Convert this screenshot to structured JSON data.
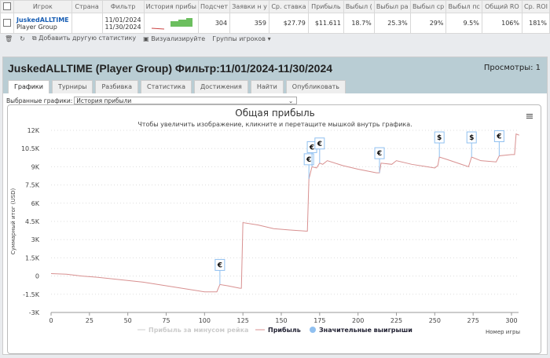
{
  "table": {
    "headers": [
      "Игрок",
      "Страна",
      "Фильтр",
      "История прибы",
      "Подсчет",
      "Заявки н у",
      "Ср. ставка",
      "Прибыль",
      "Выбыл (",
      "Выбыл ра",
      "Выбыл ср",
      "Выбыл пс",
      "Общий RO",
      "Ср. ROI"
    ],
    "row": {
      "player": "JuskedALLTIME",
      "group": "Player Group",
      "country": "",
      "filter_from": "11/01/2024",
      "filter_to": "11/30/2024",
      "count": "304",
      "entries": "359",
      "avg_stake": "$27.79",
      "profit": "$11.611",
      "c1": "18.7%",
      "c2": "25.3%",
      "c3": "29%",
      "c4": "9.5%",
      "total_roi": "106%",
      "avg_roi": "181%"
    }
  },
  "toolbar": {
    "add_stat": "Добавить другую статистику",
    "visualize": "Визуализируйте",
    "groups": "Группы игроков"
  },
  "panel": {
    "title": "JuskedALLTIME (Player Group) Фильтр:11/01/2024-11/30/2024",
    "views": "Просмотры: 1",
    "tabs": [
      "Графики",
      "Турниры",
      "Разбивка",
      "Статистика",
      "Достижения",
      "Найти",
      "Опубликовать"
    ],
    "selected_label": "Выбранные графики:",
    "selected_value": "История прибыли"
  },
  "chart_data": {
    "type": "line",
    "title": "Общая прибыль",
    "subtitle": "Чтобы увеличить изображение, кликните и перетащите мышкой внутрь графика.",
    "xlabel": "Номер игры",
    "ylabel": "Суммарный итог (USD)",
    "xlim": [
      0,
      305
    ],
    "ylim": [
      -3000,
      12000
    ],
    "xticks": [
      "0",
      "25",
      "50",
      "75",
      "100",
      "125",
      "150",
      "175",
      "200",
      "225",
      "250",
      "275",
      "300"
    ],
    "yticks": [
      "-3K",
      "-1.5K",
      "0",
      "1.5K",
      "3K",
      "4.5K",
      "6K",
      "7.5K",
      "9K",
      "10.5K",
      "12K"
    ],
    "legend": [
      "Прибыль за минусом рейка",
      "Прибыль",
      "Значительные выигрыши"
    ],
    "colors": {
      "profit": "#d89090",
      "marker": "#90c0f0",
      "rake": "#cccccc"
    },
    "series": [
      {
        "name": "Прибыль",
        "points": [
          [
            0,
            200
          ],
          [
            10,
            150
          ],
          [
            20,
            0
          ],
          [
            30,
            -100
          ],
          [
            45,
            -300
          ],
          [
            60,
            -500
          ],
          [
            75,
            -800
          ],
          [
            90,
            -1100
          ],
          [
            100,
            -1300
          ],
          [
            108,
            -1300
          ],
          [
            110,
            -700
          ],
          [
            115,
            -800
          ],
          [
            123,
            -1000
          ],
          [
            124,
            -1000
          ],
          [
            125,
            4400
          ],
          [
            135,
            4200
          ],
          [
            145,
            3900
          ],
          [
            155,
            3800
          ],
          [
            166,
            3700
          ],
          [
            167,
            3700
          ],
          [
            168,
            8000
          ],
          [
            170,
            9000
          ],
          [
            173,
            8900
          ],
          [
            175,
            9300
          ],
          [
            177,
            9200
          ],
          [
            180,
            9500
          ],
          [
            190,
            9100
          ],
          [
            200,
            8800
          ],
          [
            212,
            8500
          ],
          [
            214,
            8500
          ],
          [
            215,
            9300
          ],
          [
            222,
            9200
          ],
          [
            225,
            9500
          ],
          [
            235,
            9200
          ],
          [
            245,
            9000
          ],
          [
            250,
            8900
          ],
          [
            252,
            9100
          ],
          [
            253,
            9800
          ],
          [
            258,
            9600
          ],
          [
            265,
            9300
          ],
          [
            272,
            9000
          ],
          [
            274,
            9800
          ],
          [
            280,
            9500
          ],
          [
            290,
            9400
          ],
          [
            292,
            9900
          ],
          [
            300,
            10000
          ],
          [
            302,
            10000
          ],
          [
            303,
            11700
          ],
          [
            305,
            11600
          ]
        ]
      }
    ],
    "big_wins": [
      {
        "x": 110,
        "s": "€"
      },
      {
        "x": 168,
        "s": "€"
      },
      {
        "x": 170,
        "s": "€"
      },
      {
        "x": 175,
        "s": "€"
      },
      {
        "x": 214,
        "s": "€"
      },
      {
        "x": 253,
        "s": "$"
      },
      {
        "x": 274,
        "s": "$"
      },
      {
        "x": 292,
        "s": "€"
      }
    ]
  }
}
